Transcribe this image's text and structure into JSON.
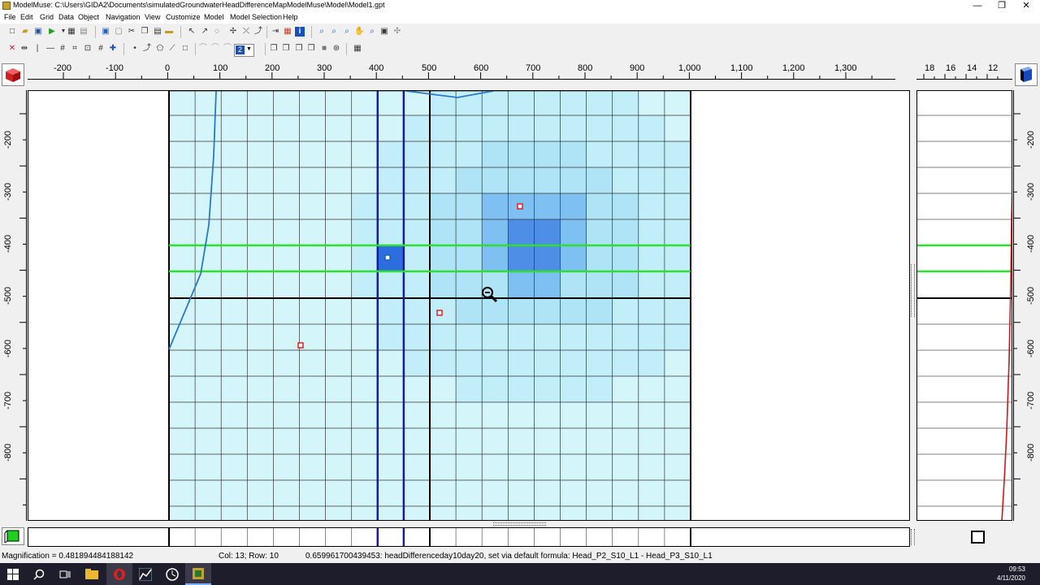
{
  "window": {
    "title": "ModelMuse: C:\\Users\\GIDA2\\Documents\\simulatedGroundwaterHeadDifferenceMapModelMuse\\Model\\Model1.gpt",
    "minimize": "—",
    "maximize": "❐",
    "close": "✕"
  },
  "menu": [
    "File",
    "Edit",
    "Grid",
    "Data",
    "Object",
    "Navigation",
    "View",
    "Customize",
    "Model",
    "Model Selection",
    "Help"
  ],
  "toolbar": {
    "layer_spin_value": "2"
  },
  "rulers": {
    "top_x_labels": [
      "-200",
      "-100",
      "0",
      "100",
      "200",
      "300",
      "400",
      "500",
      "600",
      "700",
      "800",
      "900",
      "1,000",
      "1,100",
      "1,200",
      "1,300"
    ],
    "right_panel_x_labels": [
      "18",
      "16",
      "14",
      "12"
    ],
    "left_y_labels": [
      "-200",
      "-300",
      "-400",
      "-500",
      "-600",
      "-700",
      "-800"
    ],
    "right_y_labels": [
      "-200",
      "-300",
      "-400",
      "-500",
      "-600",
      "-700",
      "-800"
    ]
  },
  "status": {
    "magnification": "Magnification = 0.481894484188142",
    "cell": "Col: 13; Row: 10",
    "value": "0.659961700439453: headDifferenceday10day20, set via default formula: Head_P2_S10_L1 - Head_P3_S10_L1"
  },
  "taskbar": {
    "time": "09:53",
    "date": "4/11/2020"
  },
  "colors": {
    "grid_fill_light": "#d4f6fb",
    "grid_fill_mid": "#aee4f6",
    "grid_fill_dark": "#7ec0f2",
    "grid_fill_peak": "#4f8ee6",
    "highlight_line": "#2ee02e",
    "column_highlight": "#1a1aa0",
    "river_line": "#2a78c8",
    "observation_marker": "#e02020"
  },
  "icons": {
    "left_view": "red-cube-icon",
    "right_view": "blue-cube-icon",
    "bottom_left": "green-cube-icon",
    "bottom_right": "frame-icon"
  }
}
